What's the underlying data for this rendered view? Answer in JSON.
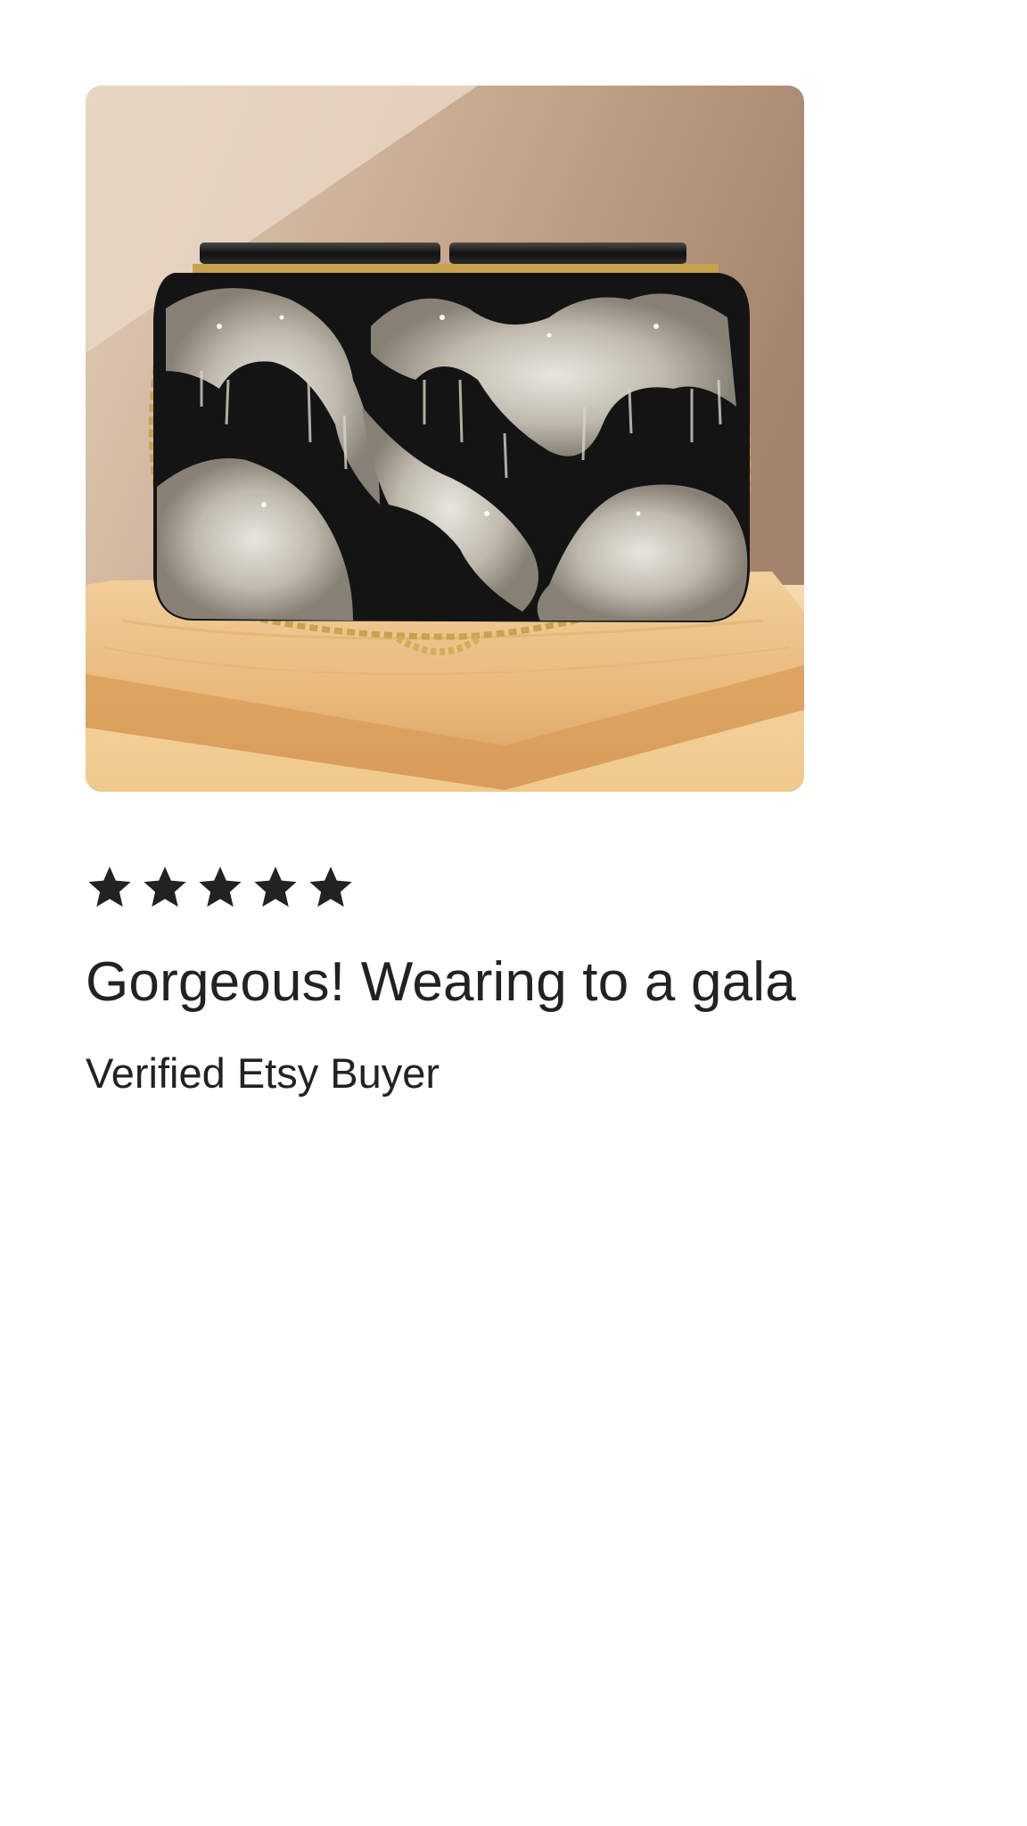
{
  "review": {
    "photo_alt": "Black clutch purse with silver sequin embroidery and gold chain on a wooden board",
    "rating": 5,
    "rating_max": 5,
    "title": "Gorgeous! Wearing to a gala",
    "reviewer": "Verified Etsy Buyer"
  },
  "colors": {
    "text": "#222222",
    "star": "#222222",
    "background": "#ffffff"
  },
  "icons": {
    "star": "star-filled-icon"
  }
}
